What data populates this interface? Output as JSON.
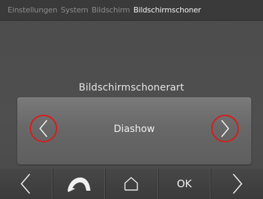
{
  "breadcrumb": [
    "Einstellungen",
    "System",
    "Bildschirm",
    "Bildschirmschoner"
  ],
  "heading": "Bildschirmschonerart",
  "selector": {
    "value": "Diashow",
    "prev_icon": "chevron-left-icon",
    "next_icon": "chevron-right-icon",
    "highlight_color": "#d61c1c"
  },
  "nav": {
    "back_icon": "chevron-left-icon",
    "undo_icon": "undo-arrow-icon",
    "home_icon": "home-icon",
    "ok_label": "OK",
    "forward_icon": "chevron-right-icon"
  }
}
